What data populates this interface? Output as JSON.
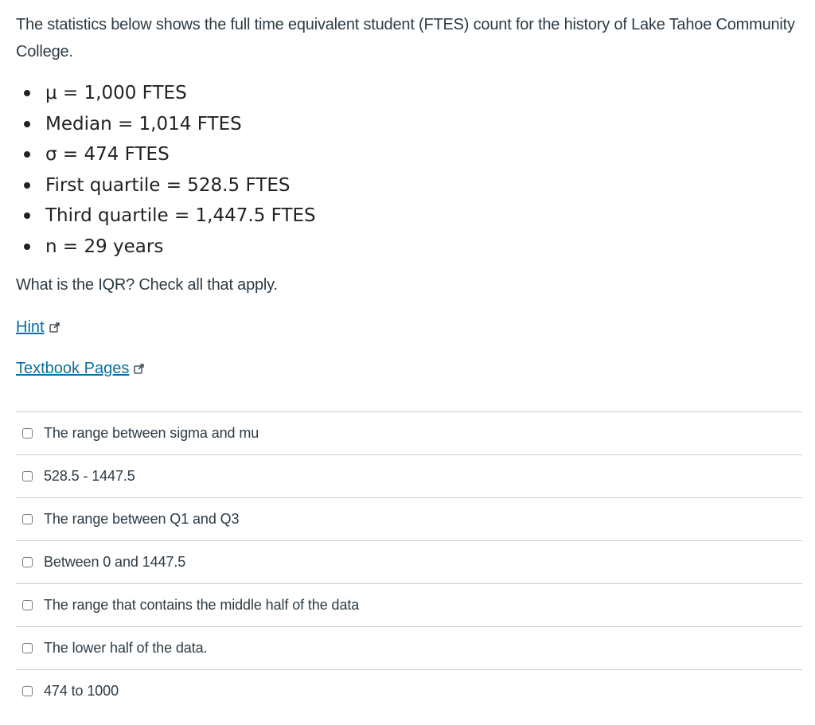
{
  "question": {
    "text": "The statistics below shows the full time equivalent student (FTES) count for the history of Lake Tahoe Community College."
  },
  "stats": [
    "μ = 1,000 FTES",
    "Median = 1,014 FTES",
    "σ = 474 FTES",
    "First quartile = 528.5 FTES",
    "Third quartile = 1,447.5 FTES",
    "n = 29 years"
  ],
  "prompt": "What is the IQR? Check all that apply.",
  "links": {
    "hint": "Hint",
    "textbook": "Textbook Pages",
    "external_icon": "external-link-icon"
  },
  "answers": [
    "The range between sigma and mu",
    "528.5 - 1447.5",
    "The range between Q1 and Q3",
    "Between 0 and 1447.5",
    "The range that contains the middle half of the data",
    "The lower half of the data.",
    "474 to 1000"
  ],
  "colors": {
    "link": "#0770a3",
    "text": "#2d3b45",
    "divider": "#c7cdd1"
  }
}
